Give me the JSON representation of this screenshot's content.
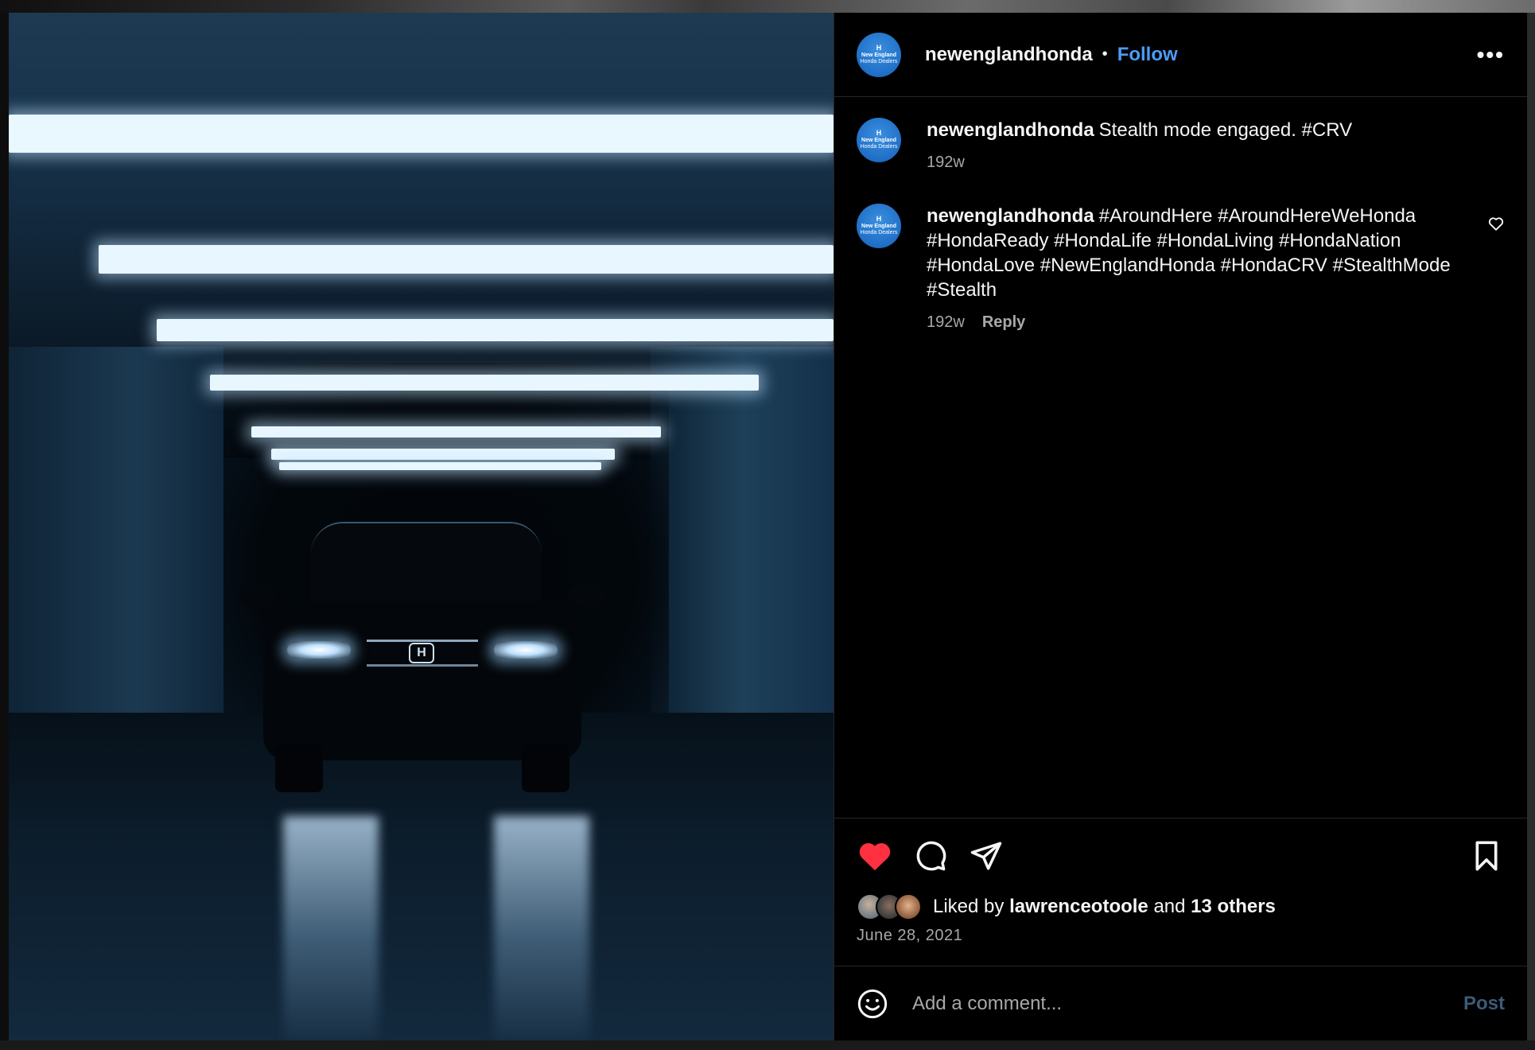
{
  "post": {
    "username": "newenglandhonda",
    "follow_label": "Follow",
    "separator": "•",
    "more_label": "•••",
    "avatar": {
      "mark": "H",
      "line1": "New England",
      "line2": "Honda Dealers"
    }
  },
  "comments": [
    {
      "author": "newenglandhonda",
      "text": "Stealth mode engaged. #CRV",
      "age": "192w",
      "reply_label": ""
    },
    {
      "author": "newenglandhonda",
      "text": "#AroundHere #AroundHereWeHonda #HondaReady #HondaLife #HondaLiving #HondaNation #HondaLove #NewEnglandHonda #HondaCRV #StealthMode #Stealth",
      "age": "192w",
      "reply_label": "Reply"
    }
  ],
  "actions": {
    "like_icon": "heart-filled-icon",
    "comment_icon": "comment-bubble-icon",
    "share_icon": "paper-plane-icon",
    "save_icon": "bookmark-icon",
    "like_color": "#ff3040"
  },
  "likes": {
    "prefix": "Liked by",
    "user": "lawrenceotoole",
    "conjunction": "and",
    "others": "13 others"
  },
  "date": "June 28, 2021",
  "add_comment": {
    "placeholder": "Add a comment...",
    "post_label": "Post",
    "emoji_icon": "smiley-icon"
  },
  "colors": {
    "accent": "#4a9df8",
    "background": "#000000",
    "muted": "#a8a8a8"
  },
  "photo": {
    "emblem": "H"
  }
}
